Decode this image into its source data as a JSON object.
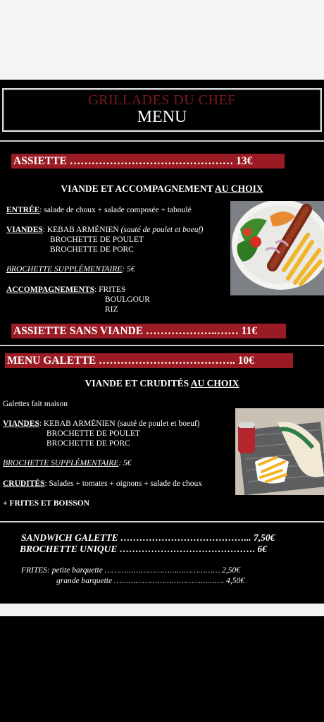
{
  "header": {
    "subtitle": "GRILLADES DU CHEF",
    "title": "MENU"
  },
  "assiette": {
    "bar_label": "ASSIETTE ……………………………………… 13€",
    "choice_text": "VIANDE ET ACCOMPAGNEMENT",
    "choice_suffix": "AU CHOIX",
    "entree_label": "ENTRÉE",
    "entree_text": ": salade de choux + salade composée + taboulé",
    "viandes_label": "VIANDES",
    "viandes_text": ": KEBAB ARMÉNIEN",
    "viandes_note": "(sauté de poulet et boeuf)",
    "viandes_2": "BROCHETTE DE POULET",
    "viandes_3": "BROCHETTE DE PORC",
    "supplement": "BROCHETTE SUPPLÉMENTAIRE",
    "supplement_price": ": 5€",
    "accomp_label": "ACCOMPAGNEMENTS",
    "accomp_1": ": FRITES",
    "accomp_2": "BOULGOUR",
    "accomp_3": "RIZ"
  },
  "sans_viande": {
    "bar_label": "ASSIETTE SANS VIANDE ………………..…… 11€"
  },
  "galette": {
    "bar_label": "MENU GALETTE ……………………………….. 10€",
    "choice_text": "VIANDE ET CRUDITÉS",
    "choice_suffix": "AU CHOIX",
    "fait_maison": "Galettes fait maison",
    "viandes_label": "VIANDES",
    "viandes_text": ": KEBAB ARMÉNIEN (sauté de poulet et boeuf)",
    "viandes_2": "BROCHETTE DE POULET",
    "viandes_3": "BROCHETTE DE PORC",
    "supplement": "BROCHETTE SUPPLÉMENTAIRE",
    "supplement_price": ": 5€",
    "crudites_label": "CRUDITÉS",
    "crudites_text": ": Salades + tomates + oignons + salade de choux",
    "extra": "+ FRITES ET BOISSON"
  },
  "extras": {
    "sandwich": "SANDWICH GALETTE …………………………………... 7,50€",
    "brochette": "BROCHETTE UNIQUE ……………………………………. 6€",
    "frites_1": "FRITES: petite barquette ………………………………………… 2,50€",
    "frites_2": "grande barquette ………………………………………. 4,50€"
  },
  "colors": {
    "accent_red": "#9b1b24",
    "header_red": "#7a1a1f",
    "background": "#000000"
  }
}
